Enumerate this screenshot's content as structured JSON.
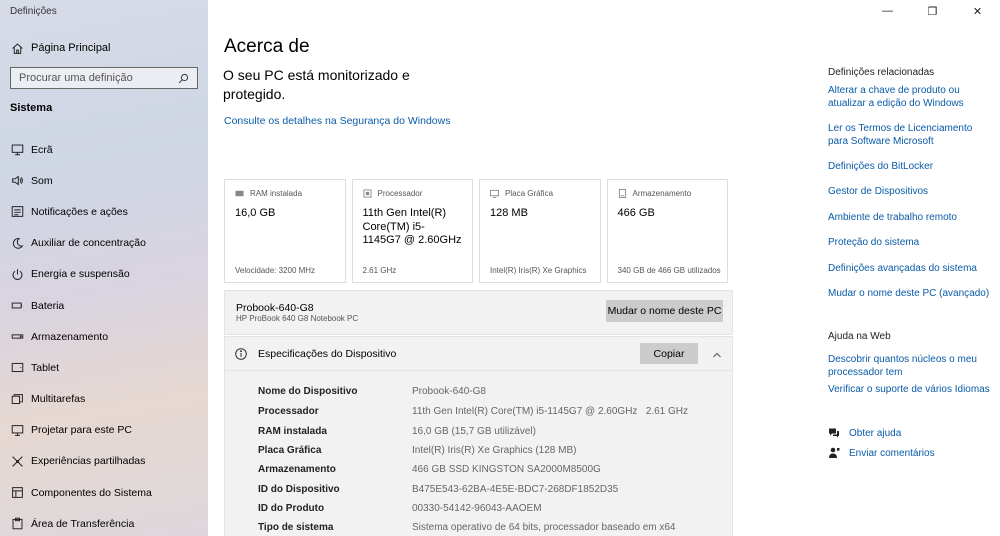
{
  "window": {
    "title": "Definições",
    "minimize": "—",
    "maximize": "❐",
    "close": "✕"
  },
  "sidebar": {
    "home_label": "Página Principal",
    "search_placeholder": "Procurar uma definição",
    "section_title": "Sistema",
    "items": [
      {
        "label": "Ecrã",
        "icon": "monitor-icon"
      },
      {
        "label": "Som",
        "icon": "speaker-icon"
      },
      {
        "label": "Notificações e ações",
        "icon": "notification-icon"
      },
      {
        "label": "Auxiliar de concentração",
        "icon": "moon-icon"
      },
      {
        "label": "Energia e suspensão",
        "icon": "power-icon"
      },
      {
        "label": "Bateria",
        "icon": "battery-icon"
      },
      {
        "label": "Armazenamento",
        "icon": "storage-icon"
      },
      {
        "label": "Tablet",
        "icon": "tablet-icon"
      },
      {
        "label": "Multitarefas",
        "icon": "multitask-icon"
      },
      {
        "label": "Projetar para este PC",
        "icon": "project-icon"
      },
      {
        "label": "Experiências partilhadas",
        "icon": "share-icon"
      },
      {
        "label": "Componentes do Sistema",
        "icon": "components-icon"
      },
      {
        "label": "Área de Transferência",
        "icon": "clipboard-icon"
      }
    ]
  },
  "main": {
    "title": "Acerca de",
    "protect_text": "O seu PC está monitorizado e protegido.",
    "security_link": "Consulte os detalhes na Segurança do Windows",
    "cards": [
      {
        "name": "ram",
        "label": "RAM instalada",
        "value": "16,0 GB",
        "foot": "Velocidade: 3200 MHz",
        "icon": "ram-icon"
      },
      {
        "name": "processor",
        "label": "Processador",
        "value": "11th Gen Intel(R) Core(TM) i5-1145G7 @ 2.60GHz",
        "foot": "2.61 GHz",
        "icon": "cpu-icon"
      },
      {
        "name": "graphics",
        "label": "Placa Gráfica",
        "value": "128 MB",
        "foot": "Intel(R) Iris(R) Xe Graphics",
        "icon": "gpu-icon"
      },
      {
        "name": "storage",
        "label": "Armazenamento",
        "value": "466 GB",
        "foot": "340 GB de 466 GB utilizados",
        "icon": "disk-icon"
      }
    ],
    "pc_name": "Probook-640-G8",
    "pc_model": "HP ProBook 640 G8 Notebook PC",
    "rename_button": "Mudar o nome deste PC",
    "spec_title": "Especificações do Dispositivo",
    "copy_button": "Copiar",
    "specs": [
      {
        "label": "Nome do Dispositivo",
        "value": "Probook-640-G8"
      },
      {
        "label": "Processador",
        "value": "11th Gen Intel(R) Core(TM) i5-1145G7 @ 2.60GHz   2.61 GHz"
      },
      {
        "label": "RAM instalada",
        "value": "16,0 GB (15,7 GB utilizável)"
      },
      {
        "label": "Placa Gráfica",
        "value": "Intel(R) Iris(R) Xe Graphics (128 MB)"
      },
      {
        "label": "Armazenamento",
        "value": "466 GB SSD KINGSTON SA2000M8500G"
      },
      {
        "label": "ID do Dispositivo",
        "value": "B475E543-62BA-4E5E-BDC7-268DF1852D35"
      },
      {
        "label": "ID do Produto",
        "value": "00330-54142-96043-AAOEM"
      },
      {
        "label": "Tipo de sistema",
        "value": "Sistema operativo de 64 bits, processador baseado em x64"
      }
    ]
  },
  "related": {
    "heading": "Definições relacionadas",
    "links": [
      "Alterar a chave de produto ou atualizar a edição do Windows",
      "Ler os Termos de Licenciamento para Software Microsoft",
      "Definições do BitLocker",
      "Gestor de Dispositivos",
      "Ambiente de trabalho remoto",
      "Proteção do sistema",
      "Definições avançadas do sistema",
      "Mudar o nome deste PC (avançado)"
    ]
  },
  "web_help": {
    "heading": "Ajuda na Web",
    "links": [
      "Descobrir quantos núcleos o meu processador tem",
      "Verificar o suporte de vários Idiomas"
    ]
  },
  "support": {
    "help_link": "Obter ajuda",
    "feedback_link": "Enviar comentários"
  },
  "colors": {
    "accent_link": "#0a5ba8",
    "button_gray": "#cccccc",
    "panel_gray": "#f2f2f2"
  }
}
